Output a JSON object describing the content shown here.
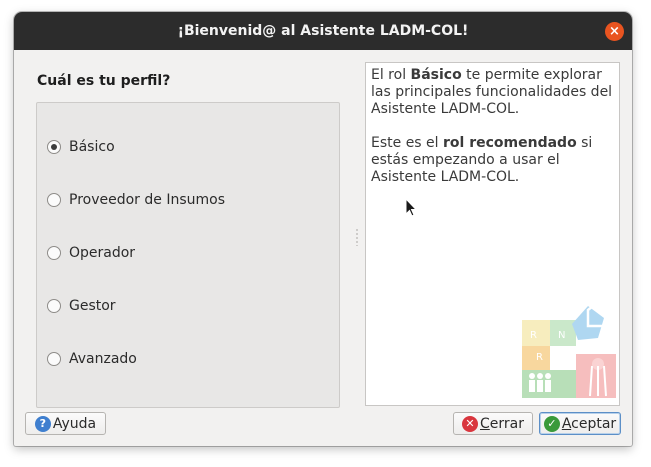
{
  "window": {
    "title": "¡Bienvenid@ al Asistente LADM-COL!",
    "close_glyph": "×"
  },
  "profile": {
    "title": "Cuál es tu perfil?",
    "options": [
      {
        "label": "Básico",
        "checked": true
      },
      {
        "label": "Proveedor de Insumos",
        "checked": false
      },
      {
        "label": "Operador",
        "checked": false
      },
      {
        "label": "Gestor",
        "checked": false
      },
      {
        "label": "Avanzado",
        "checked": false
      }
    ]
  },
  "info": {
    "p1_pre": "El rol ",
    "p1_bold": "Básico",
    "p1_post": " te permite explorar las principales funcionalidades del Asistente LADM-COL.",
    "p2_pre": "Este es el ",
    "p2_bold": "rol recomendado",
    "p2_post": " si estás empezando a usar el Asistente LADM-COL."
  },
  "buttons": {
    "help": {
      "label": "Ayuda",
      "icon": "help-icon"
    },
    "close": {
      "label_first": "C",
      "label_rest": "errar",
      "icon": "cancel-icon"
    },
    "accept": {
      "label_first": "A",
      "label_rest": "ceptar",
      "icon": "check-icon"
    }
  },
  "logo_letters": {
    "r1": "R",
    "r2": "R",
    "n": "N"
  },
  "colors": {
    "titlebar": "#2c2c2c",
    "close_accent": "#e95420",
    "help_blue": "#3f7fcf",
    "cancel_red": "#d9363e",
    "accept_green": "#3a9a3a"
  }
}
